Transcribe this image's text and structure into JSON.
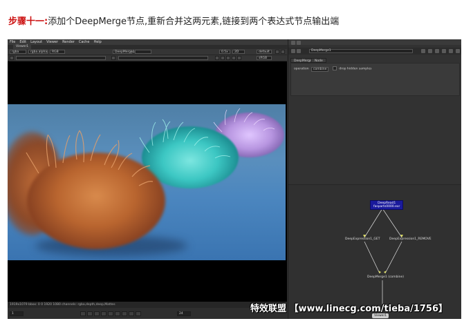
{
  "step": {
    "label": "步骤十一:",
    "text": "添加个DeepMerge节点,重新合并这两元素,链接到两个表达式节点输出端"
  },
  "menu": [
    "File",
    "Edit",
    "Layout",
    "Viewer",
    "Render",
    "Cache",
    "Help"
  ],
  "viewer": {
    "tab": "Viewer1",
    "channels": "rgba",
    "alpha": "rgba.alpha",
    "colorspace": "RGB",
    "input_a": "DeepMerge1",
    "zoom": "0.5x",
    "proxy": "2D",
    "display": "default",
    "format": "sRGB",
    "info": "1919x1079  bbox: 0 0 1920 1080  channels: rgba,depth,deep,Mattes"
  },
  "timeline": {
    "frame": "1",
    "fps": "24"
  },
  "properties": {
    "node_name": "DeepMerge1",
    "tabs": [
      "DeepMerge",
      "Node"
    ],
    "operation_label": "operation",
    "operation_value": "combine",
    "drop_hidden_label": "drop hidden samples"
  },
  "nodegraph": {
    "read": {
      "name": "DeepRead1",
      "file": "fasparts0000.exr"
    },
    "expr_left": "DeepExpression1_GET",
    "expr_right": "DeepExpression1_REMOVE",
    "merge": "DeepMerge1 (combine)",
    "viewer": "Viewer1"
  },
  "watermark": "特效联盟 【www.linecg.com/tieba/1756】",
  "colors": {
    "step_label": "#cc1111",
    "read_node": "#1a1a9c",
    "app_bg": "#313131"
  }
}
